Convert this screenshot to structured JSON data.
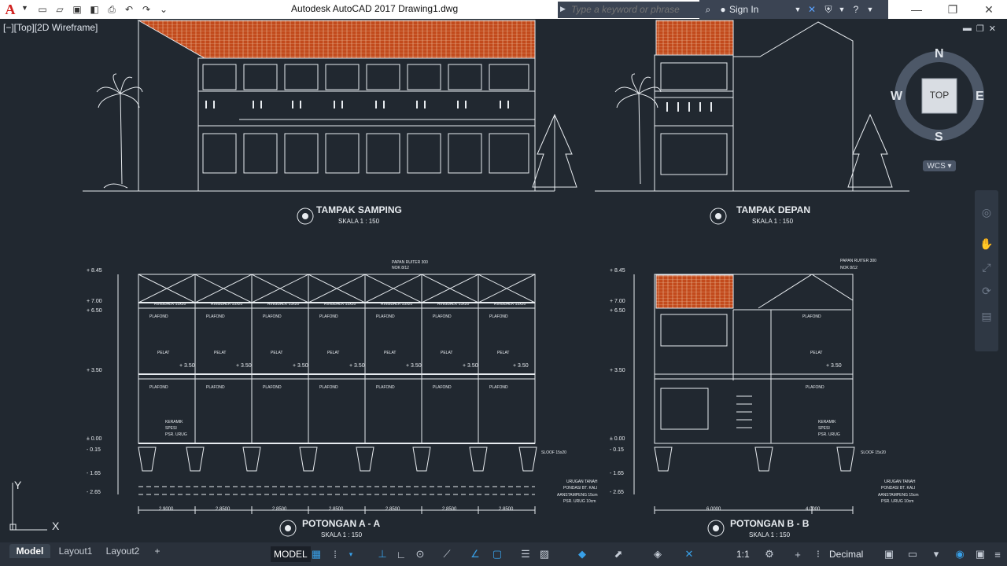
{
  "app": {
    "title": "Autodesk AutoCAD 2017    Drawing1.dwg",
    "logo": "A"
  },
  "quick_access": [
    "new-icon",
    "open-icon",
    "save-icon",
    "saveas-icon",
    "plot-icon",
    "undo-icon",
    "redo-icon",
    "workspace-dropdown-icon"
  ],
  "search": {
    "placeholder": "Type a keyword or phrase"
  },
  "account": {
    "sign_in": "Sign In"
  },
  "viewport": {
    "label": "[−][Top][2D Wireframe]"
  },
  "viewcube": {
    "n": "N",
    "s": "S",
    "e": "E",
    "w": "W",
    "face": "TOP",
    "wcs": "WCS"
  },
  "drawing": {
    "view1_title": "TAMPAK SAMPING",
    "view1_scale": "SKALA  1 : 150",
    "view2_title": "TAMPAK DEPAN",
    "view2_scale": "SKALA  1 : 150",
    "view3_title": "POTONGAN A - A",
    "view3_scale": "SKALA  1 : 150",
    "view4_title": "POTONGAN B - B",
    "view4_scale": "SKALA  1 : 150",
    "levels": [
      "+ 8.45",
      "+ 7.00",
      "+ 6.50",
      "+ 3.50",
      "± 0.00",
      "- 0.15",
      "- 1.65",
      "- 2.65"
    ],
    "dims_a": [
      "2.9000",
      "2.8500",
      "2.8500",
      "2.8500",
      "2.8500",
      "2.8500",
      "2.8500"
    ],
    "dims_b": [
      "6.0000",
      "4.0000"
    ],
    "note_floor": "+ 3.50",
    "label_plafond": "PLAFOND",
    "label_pelat": "PELAT",
    "label_ringbalk": "RINGBALK 15x20",
    "label_keramik": "KERAMIK",
    "label_spesi": "SPESI",
    "label_psr": "PSR. URUG",
    "label_papan": "PAPAN RUITER 300",
    "label_nok": "NOK 8/12",
    "label_sloof": "SLOOF 15x20",
    "foundation_notes": [
      "URUGAN TANAH",
      "PONDASI BT. KALI",
      "AANSTAMPENG 15cm",
      "PSR. URUG 10cm"
    ]
  },
  "ucs": {
    "x": "X",
    "y": "Y"
  },
  "layout_tabs": [
    "Model",
    "Layout1",
    "Layout2",
    "+"
  ],
  "status": {
    "model": "MODEL",
    "scale": "1:1",
    "units": "Decimal"
  },
  "colors": {
    "background": "#212830",
    "line": "#ffffff",
    "roof": "#c24a1c",
    "accent": "#38a0e8"
  }
}
